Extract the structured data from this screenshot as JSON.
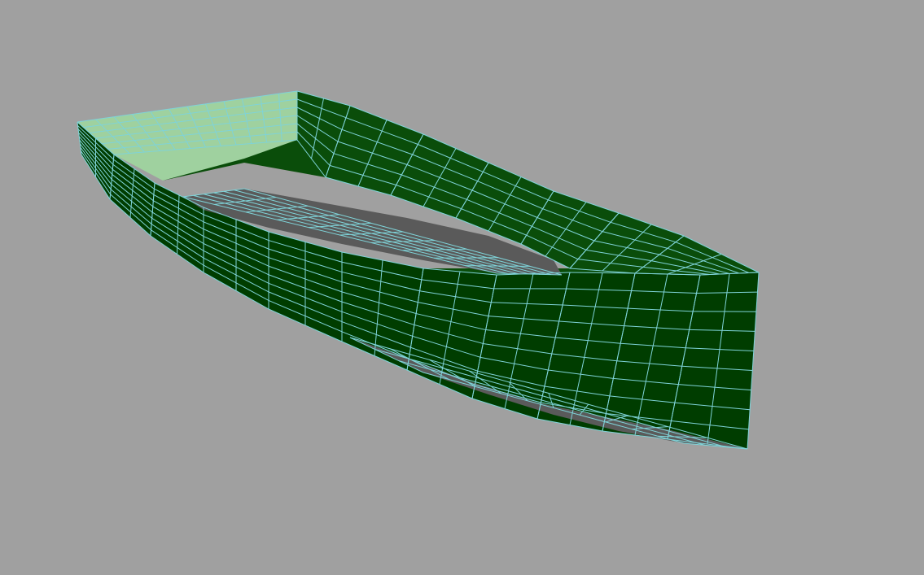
{
  "viewport": {
    "background_color": "#a0a0a0",
    "object": "boat-hull-mesh"
  },
  "mesh": {
    "colors": {
      "hull_dark": "#003d00",
      "hull_mid": "#0a4d0a",
      "interior_selected": "#9fd19f",
      "deck_gray": "#5a5a5a",
      "wireframe": "#7fd3d8"
    }
  }
}
